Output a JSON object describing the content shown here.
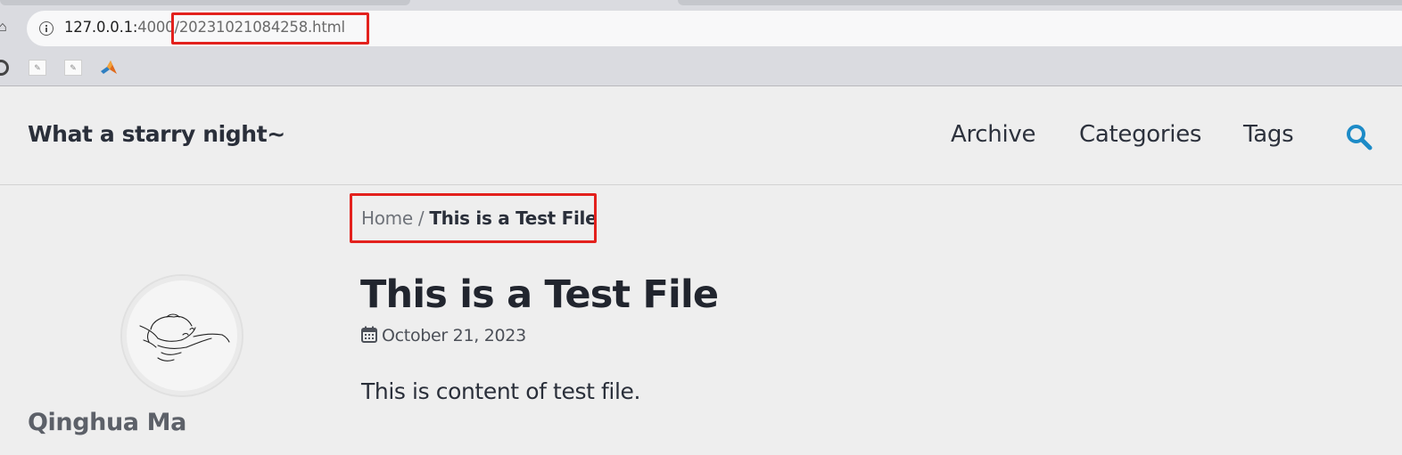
{
  "browser": {
    "url_host": "127.0.0.1:",
    "url_path": "4000/",
    "url_file": "20231021084258.html"
  },
  "bookmarks": [
    {
      "icon": "github-icon"
    },
    {
      "icon": "page-icon"
    },
    {
      "icon": "page-icon"
    },
    {
      "icon": "matlab-icon"
    }
  ],
  "site": {
    "title": "What a starry night~",
    "nav": [
      "Archive",
      "Categories",
      "Tags"
    ],
    "search_icon": "search-icon",
    "accent_color": "#1d8bc7"
  },
  "sidebar": {
    "author_name": "Qinghua Ma"
  },
  "post": {
    "breadcrumb_home": "Home",
    "breadcrumb_sep": "/",
    "breadcrumb_current": "This is a Test File",
    "title": "This is a Test File",
    "date": "October 21, 2023",
    "body": "This is content of test file."
  },
  "annotation_color": "#e3211d"
}
